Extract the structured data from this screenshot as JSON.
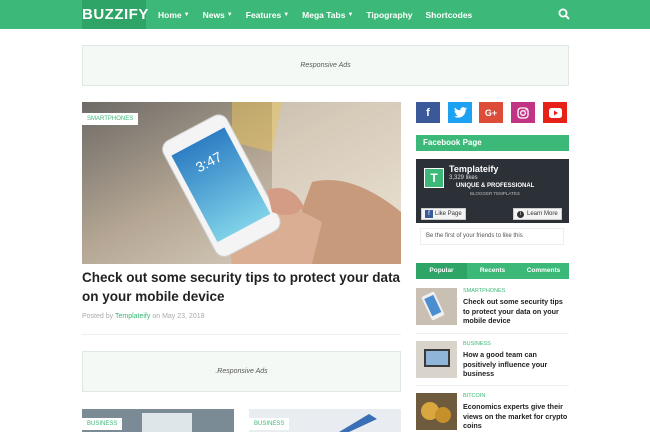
{
  "header": {
    "logo": "BUZZIFY",
    "nav": [
      {
        "label": "Home",
        "dropdown": true
      },
      {
        "label": "News",
        "dropdown": true
      },
      {
        "label": "Features",
        "dropdown": true
      },
      {
        "label": "Mega Tabs",
        "dropdown": true
      },
      {
        "label": "Tipography",
        "dropdown": false
      },
      {
        "label": "Shortcodes",
        "dropdown": false
      }
    ],
    "search_icon": "search-icon"
  },
  "ads": {
    "top": "Responsive Ads",
    "middle": ".Responsive Ads"
  },
  "hero": {
    "category": "SMARTPHONES",
    "title": "Check out some security tips to protect your data on your mobile device",
    "posted_by": "Posted by",
    "author": "Templateify",
    "on": "on",
    "date": "May 23, 2018"
  },
  "bottom_posts": [
    {
      "category": "BUSINESS"
    },
    {
      "category": "BUSINESS"
    }
  ],
  "sidebar": {
    "social": [
      {
        "icon": "facebook-icon",
        "glyph": "f",
        "color": "#3b5998"
      },
      {
        "icon": "twitter-icon",
        "glyph": "t",
        "color": "#1da1f2"
      },
      {
        "icon": "google-plus-icon",
        "glyph": "G+",
        "color": "#dd4b39"
      },
      {
        "icon": "instagram-icon",
        "glyph": "◎",
        "color": "#c13584"
      },
      {
        "icon": "youtube-icon",
        "glyph": "▶",
        "color": "#e62117"
      }
    ],
    "facebook_title": "Facebook Page",
    "fb": {
      "logo_letter": "T",
      "name": "Templateify",
      "likes": "3,329 likes",
      "tagline": "UNIQUE & PROFESSIONAL",
      "sub": "BLOGGER TEMPLATES",
      "like_btn": "Like Page",
      "learn_btn": "Learn More",
      "friends": "Be the first of your friends to like this"
    },
    "tabs": [
      "Popular",
      "Recents",
      "Comments"
    ],
    "posts": [
      {
        "category": "SMARTPHONES",
        "title": "Check out some security tips to protect your data on your mobile device"
      },
      {
        "category": "BUSINESS",
        "title": "How a good team can positively influence your business"
      },
      {
        "category": "BITCOIN",
        "title": "Economics experts give their views on the market for crypto coins"
      }
    ]
  },
  "colors": {
    "accent": "#3cb878",
    "accent_dark": "#2ea466"
  }
}
